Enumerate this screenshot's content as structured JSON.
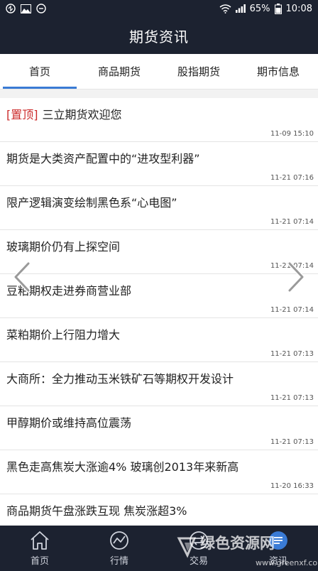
{
  "status_bar": {
    "battery": "65%",
    "time": "10:08",
    "icons": [
      "message-icon",
      "image-icon",
      "notification-icon",
      "wifi-icon",
      "signal-icon",
      "battery-icon"
    ]
  },
  "header": {
    "title": "期货资讯"
  },
  "tabs": [
    {
      "label": "首页",
      "active": true
    },
    {
      "label": "商品期货",
      "active": false
    },
    {
      "label": "股指期货",
      "active": false
    },
    {
      "label": "期市信息",
      "active": false
    }
  ],
  "news": [
    {
      "tag": "[置顶]",
      "title": "三立期货欢迎您",
      "time": "11-09 15:10"
    },
    {
      "tag": "",
      "title": "期货是大类资产配置中的“进攻型利器”",
      "time": "11-21 07:16"
    },
    {
      "tag": "",
      "title": "限产逻辑演变绘制黑色系“心电图”",
      "time": "11-21 07:14"
    },
    {
      "tag": "",
      "title": "玻璃期价仍有上探空间",
      "time": "11-21 07:14"
    },
    {
      "tag": "",
      "title": "豆粕期权走进券商营业部",
      "time": "11-21 07:14"
    },
    {
      "tag": "",
      "title": "菜粕期价上行阻力增大",
      "time": "11-21 07:13"
    },
    {
      "tag": "",
      "title": "大商所：全力推动玉米铁矿石等期权开发设计",
      "time": "11-21 07:13"
    },
    {
      "tag": "",
      "title": "甲醇期价或维持高位震荡",
      "time": "11-21 07:13"
    },
    {
      "tag": "",
      "title": "黑色走高焦炭大涨逾4% 玻璃创2013年来新高",
      "time": "11-20 16:33"
    },
    {
      "tag": "",
      "title": "商品期货午盘涨跌互现 焦炭涨超3%",
      "time": ""
    }
  ],
  "bottom_nav": [
    {
      "label": "首页",
      "icon": "home-icon"
    },
    {
      "label": "行情",
      "icon": "chart-icon"
    },
    {
      "label": "交易",
      "icon": "trade-icon"
    },
    {
      "label": "资讯",
      "icon": "news-icon"
    }
  ],
  "watermark": {
    "text": "绿色资源网",
    "url": "www.greenxf.com"
  },
  "colors": {
    "dark_bar": "#1c2230",
    "accent": "#3a7bd5",
    "pin": "#cc2b2b"
  }
}
